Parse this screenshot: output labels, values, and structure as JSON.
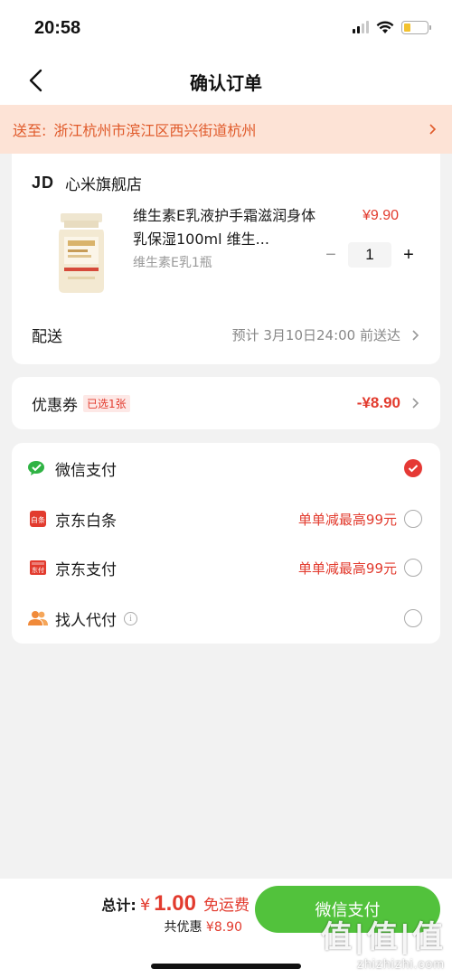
{
  "status_bar": {
    "time": "20:58",
    "battery_color": "#f2c230"
  },
  "nav": {
    "title": "确认订单",
    "back_icon": "chevron-left-icon"
  },
  "address": {
    "label": "送至:",
    "text": "浙江杭州市滨江区西兴街道杭州",
    "color": "#e05a2a"
  },
  "store": {
    "logo": "JD",
    "name": "心米旗舰店",
    "product": {
      "title": "维生素E乳液护手霜滋润身体乳保湿100ml 维生...",
      "spec": "维生素E乳1瓶",
      "price": "¥9.90",
      "quantity": "1",
      "minus": "−",
      "plus": "+"
    },
    "delivery": {
      "label": "配送",
      "value": "预计 3月10日24:00 前送达"
    }
  },
  "coupon": {
    "label": "优惠券",
    "badge": "已选1张",
    "value": "-¥8.90"
  },
  "payment_methods": [
    {
      "label": "微信支付",
      "promo": "",
      "selected": true,
      "icon": "wechat-pay-icon"
    },
    {
      "label": "京东白条",
      "promo": "单单减最高99元",
      "selected": false,
      "icon": "baitiao-icon"
    },
    {
      "label": "京东支付",
      "promo": "单单减最高99元",
      "selected": false,
      "icon": "jd-pay-icon"
    },
    {
      "label": "找人代付",
      "promo": "",
      "selected": false,
      "icon": "friends-pay-icon",
      "info": "i"
    }
  ],
  "icon_text": {
    "baitiao": "白条",
    "jdpay": "东付"
  },
  "bottom": {
    "total_label": "总计:",
    "currency": "¥",
    "total_amount": "1.00",
    "free_shipping": "免运费",
    "saving_label": "共优惠",
    "saving_value": "¥8.90",
    "pay_button": "微信支付",
    "accent": "#e23b2e",
    "button_color": "#52c23c"
  },
  "watermark": {
    "big": "值|值|值",
    "small": "zhizhizhi.com"
  }
}
